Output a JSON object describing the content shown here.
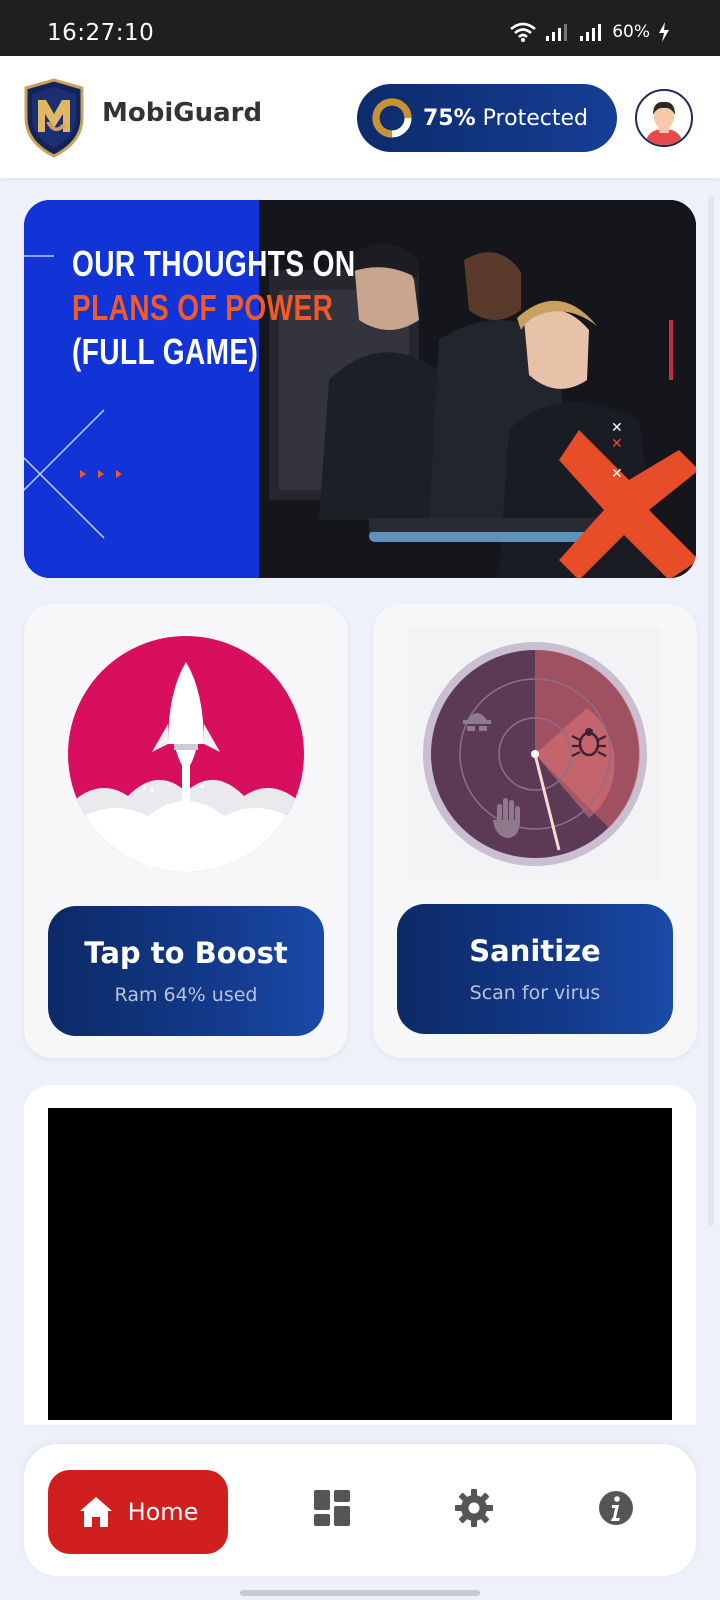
{
  "status_bar": {
    "time": "16:27:10",
    "battery": "60%"
  },
  "header": {
    "app_name": "MobiGuard",
    "protection_percent": "75%",
    "protection_label": "Protected",
    "protection_value": 0.75,
    "colors": {
      "ring_accent": "#c9922e",
      "pill": "#0d2b6b"
    }
  },
  "banner": {
    "line1": "OUR THOUGHTS ON",
    "line2": "PLANS OF POWER",
    "line3": "(FULL GAME)",
    "colors": {
      "panel": "#1233d6",
      "accent": "#f05a28"
    }
  },
  "boost_card": {
    "title": "Tap to Boost",
    "subtitle": "Ram 64% used",
    "icon": "rocket-icon",
    "color": "#d80e5e"
  },
  "sanitize_card": {
    "title": "Sanitize",
    "subtitle": "Scan for virus",
    "icon": "radar-icon"
  },
  "bottom_nav": {
    "items": [
      {
        "label": "Home",
        "icon": "home-icon",
        "active": true
      },
      {
        "label": "",
        "icon": "dashboard-icon",
        "active": false
      },
      {
        "label": "",
        "icon": "gear-icon",
        "active": false
      },
      {
        "label": "",
        "icon": "info-icon",
        "active": false
      }
    ],
    "active_color": "#d11f1f"
  }
}
